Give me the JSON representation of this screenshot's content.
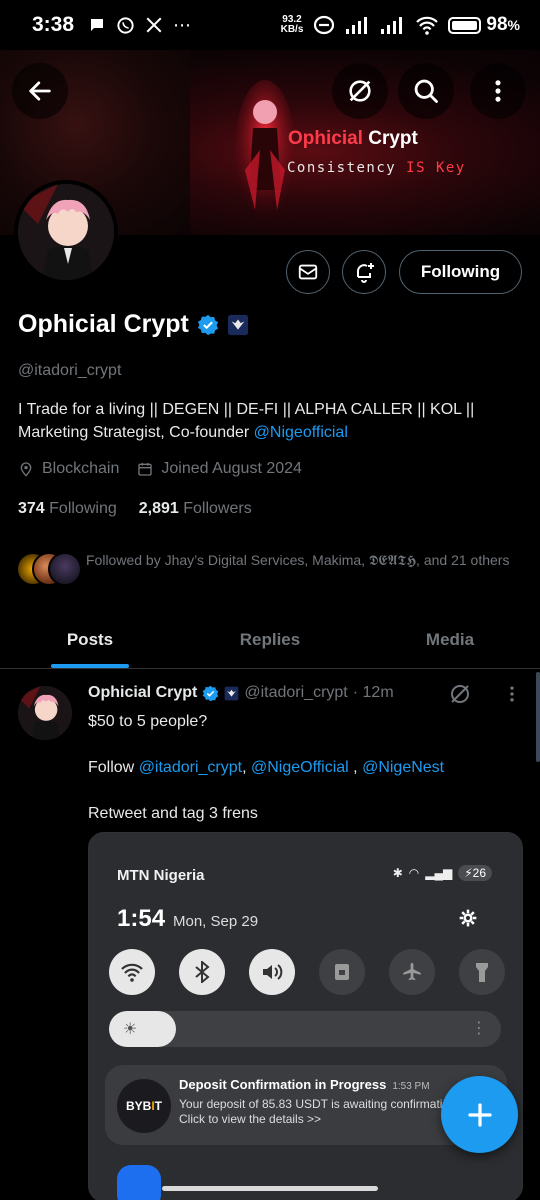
{
  "status_bar": {
    "time": "3:38",
    "speed_top": "93.2",
    "speed_bottom": "KB/s",
    "battery": "98",
    "battery_suffix": "%",
    "battery_level": 0.98
  },
  "banner": {
    "title_accent": "Ophicial",
    "title_rest": " Crypt",
    "subtitle_prefix": "Consistency ",
    "subtitle_accent": "IS Key"
  },
  "profile": {
    "name": "Ophicial Crypt",
    "handle": "@itadori_crypt",
    "bio_line1": "I Trade for a living || DEGEN || DE-FI || ALPHA CALLER || KOL ||",
    "bio_line2_prefix": "Marketing Strategist, Co-founder ",
    "bio_link": "@Nigeofficial",
    "location": "Blockchain",
    "joined": "Joined August 2024",
    "following_count": "374",
    "following_label": "Following",
    "followers_count": "2,891",
    "followers_label": "Followers",
    "followed_by": "Followed by Jhay’s Digital Services, Makima, 𝕯𝕰𝕬𝕿𝕳, and 21 others",
    "follow_button": "Following"
  },
  "tabs": [
    {
      "label": "Posts",
      "active": true
    },
    {
      "label": "Replies",
      "active": false
    },
    {
      "label": "Media",
      "active": false
    }
  ],
  "post": {
    "name": "Ophicial Crypt",
    "handle": "@itadori_crypt",
    "time": "· 12m",
    "line1": "$50 to 5 people?",
    "line2_prefix": "Follow ",
    "mention1": "@itadori_crypt",
    "sep1": ", ",
    "mention2": "@NigeOfficial",
    "sep2": " , ",
    "mention3": "@NigeNest",
    "line3": "Retweet and tag 3 frens"
  },
  "media": {
    "carrier": "MTN Nigeria",
    "battery": "26",
    "time": "1:54",
    "date": "Mon, Sep 29",
    "brightness_level": 0.17,
    "notif_app": "BYB",
    "notif_app_accent": "I",
    "notif_app_end": "T",
    "notif_title": "Deposit Confirmation in Progress",
    "notif_time": "1:53 PM",
    "notif_body1": "Your deposit of 85.83 USDT is awaiting confirmation",
    "notif_body2": "Click to view the details >>"
  },
  "colors": {
    "accent": "#1d9bf0",
    "muted": "#71767b",
    "banner_red": "#ff3b4a"
  }
}
